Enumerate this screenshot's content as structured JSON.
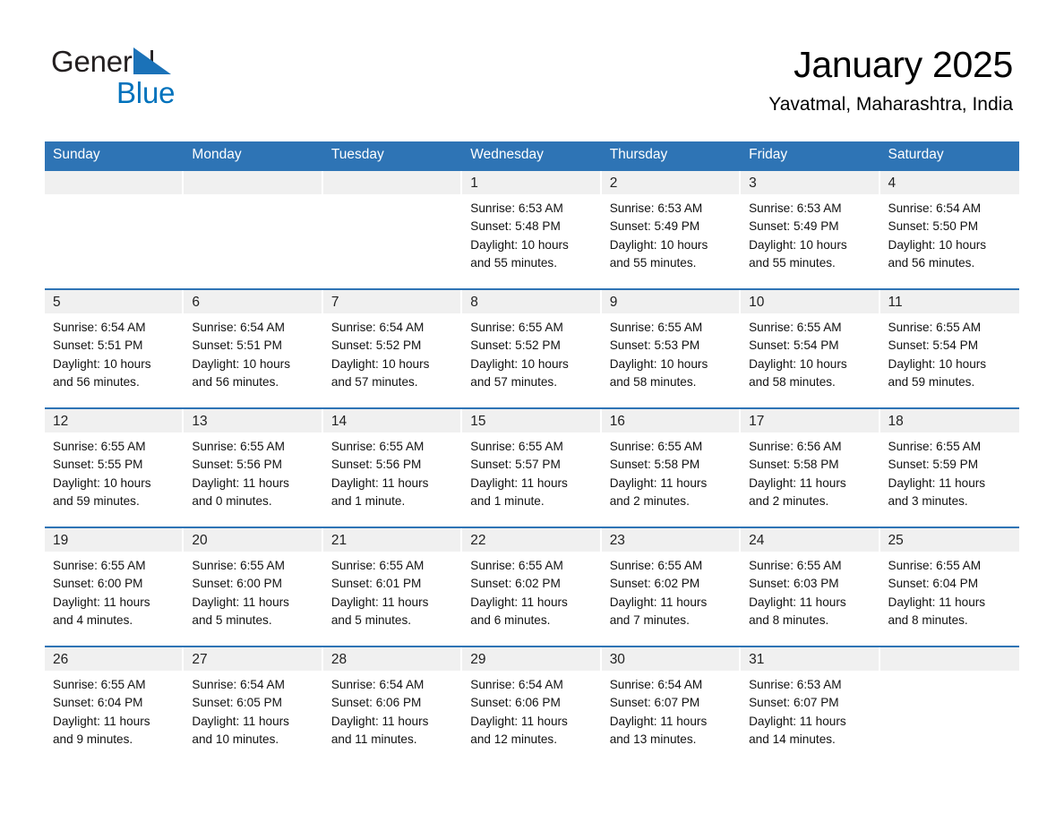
{
  "brand": {
    "name_part1": "General",
    "name_part2": "Blue",
    "triangle_icon": "triangle-icon",
    "accent_color": "#0072bc",
    "header_color": "#2e74b5"
  },
  "header": {
    "month_title": "January 2025",
    "location": "Yavatmal, Maharashtra, India"
  },
  "weekdays": [
    "Sunday",
    "Monday",
    "Tuesday",
    "Wednesday",
    "Thursday",
    "Friday",
    "Saturday"
  ],
  "weeks": [
    [
      {
        "day": "",
        "sunrise": "",
        "sunset": "",
        "daylight_line1": "",
        "daylight_line2": ""
      },
      {
        "day": "",
        "sunrise": "",
        "sunset": "",
        "daylight_line1": "",
        "daylight_line2": ""
      },
      {
        "day": "",
        "sunrise": "",
        "sunset": "",
        "daylight_line1": "",
        "daylight_line2": ""
      },
      {
        "day": "1",
        "sunrise": "Sunrise: 6:53 AM",
        "sunset": "Sunset: 5:48 PM",
        "daylight_line1": "Daylight: 10 hours",
        "daylight_line2": "and 55 minutes."
      },
      {
        "day": "2",
        "sunrise": "Sunrise: 6:53 AM",
        "sunset": "Sunset: 5:49 PM",
        "daylight_line1": "Daylight: 10 hours",
        "daylight_line2": "and 55 minutes."
      },
      {
        "day": "3",
        "sunrise": "Sunrise: 6:53 AM",
        "sunset": "Sunset: 5:49 PM",
        "daylight_line1": "Daylight: 10 hours",
        "daylight_line2": "and 55 minutes."
      },
      {
        "day": "4",
        "sunrise": "Sunrise: 6:54 AM",
        "sunset": "Sunset: 5:50 PM",
        "daylight_line1": "Daylight: 10 hours",
        "daylight_line2": "and 56 minutes."
      }
    ],
    [
      {
        "day": "5",
        "sunrise": "Sunrise: 6:54 AM",
        "sunset": "Sunset: 5:51 PM",
        "daylight_line1": "Daylight: 10 hours",
        "daylight_line2": "and 56 minutes."
      },
      {
        "day": "6",
        "sunrise": "Sunrise: 6:54 AM",
        "sunset": "Sunset: 5:51 PM",
        "daylight_line1": "Daylight: 10 hours",
        "daylight_line2": "and 56 minutes."
      },
      {
        "day": "7",
        "sunrise": "Sunrise: 6:54 AM",
        "sunset": "Sunset: 5:52 PM",
        "daylight_line1": "Daylight: 10 hours",
        "daylight_line2": "and 57 minutes."
      },
      {
        "day": "8",
        "sunrise": "Sunrise: 6:55 AM",
        "sunset": "Sunset: 5:52 PM",
        "daylight_line1": "Daylight: 10 hours",
        "daylight_line2": "and 57 minutes."
      },
      {
        "day": "9",
        "sunrise": "Sunrise: 6:55 AM",
        "sunset": "Sunset: 5:53 PM",
        "daylight_line1": "Daylight: 10 hours",
        "daylight_line2": "and 58 minutes."
      },
      {
        "day": "10",
        "sunrise": "Sunrise: 6:55 AM",
        "sunset": "Sunset: 5:54 PM",
        "daylight_line1": "Daylight: 10 hours",
        "daylight_line2": "and 58 minutes."
      },
      {
        "day": "11",
        "sunrise": "Sunrise: 6:55 AM",
        "sunset": "Sunset: 5:54 PM",
        "daylight_line1": "Daylight: 10 hours",
        "daylight_line2": "and 59 minutes."
      }
    ],
    [
      {
        "day": "12",
        "sunrise": "Sunrise: 6:55 AM",
        "sunset": "Sunset: 5:55 PM",
        "daylight_line1": "Daylight: 10 hours",
        "daylight_line2": "and 59 minutes."
      },
      {
        "day": "13",
        "sunrise": "Sunrise: 6:55 AM",
        "sunset": "Sunset: 5:56 PM",
        "daylight_line1": "Daylight: 11 hours",
        "daylight_line2": "and 0 minutes."
      },
      {
        "day": "14",
        "sunrise": "Sunrise: 6:55 AM",
        "sunset": "Sunset: 5:56 PM",
        "daylight_line1": "Daylight: 11 hours",
        "daylight_line2": "and 1 minute."
      },
      {
        "day": "15",
        "sunrise": "Sunrise: 6:55 AM",
        "sunset": "Sunset: 5:57 PM",
        "daylight_line1": "Daylight: 11 hours",
        "daylight_line2": "and 1 minute."
      },
      {
        "day": "16",
        "sunrise": "Sunrise: 6:55 AM",
        "sunset": "Sunset: 5:58 PM",
        "daylight_line1": "Daylight: 11 hours",
        "daylight_line2": "and 2 minutes."
      },
      {
        "day": "17",
        "sunrise": "Sunrise: 6:56 AM",
        "sunset": "Sunset: 5:58 PM",
        "daylight_line1": "Daylight: 11 hours",
        "daylight_line2": "and 2 minutes."
      },
      {
        "day": "18",
        "sunrise": "Sunrise: 6:55 AM",
        "sunset": "Sunset: 5:59 PM",
        "daylight_line1": "Daylight: 11 hours",
        "daylight_line2": "and 3 minutes."
      }
    ],
    [
      {
        "day": "19",
        "sunrise": "Sunrise: 6:55 AM",
        "sunset": "Sunset: 6:00 PM",
        "daylight_line1": "Daylight: 11 hours",
        "daylight_line2": "and 4 minutes."
      },
      {
        "day": "20",
        "sunrise": "Sunrise: 6:55 AM",
        "sunset": "Sunset: 6:00 PM",
        "daylight_line1": "Daylight: 11 hours",
        "daylight_line2": "and 5 minutes."
      },
      {
        "day": "21",
        "sunrise": "Sunrise: 6:55 AM",
        "sunset": "Sunset: 6:01 PM",
        "daylight_line1": "Daylight: 11 hours",
        "daylight_line2": "and 5 minutes."
      },
      {
        "day": "22",
        "sunrise": "Sunrise: 6:55 AM",
        "sunset": "Sunset: 6:02 PM",
        "daylight_line1": "Daylight: 11 hours",
        "daylight_line2": "and 6 minutes."
      },
      {
        "day": "23",
        "sunrise": "Sunrise: 6:55 AM",
        "sunset": "Sunset: 6:02 PM",
        "daylight_line1": "Daylight: 11 hours",
        "daylight_line2": "and 7 minutes."
      },
      {
        "day": "24",
        "sunrise": "Sunrise: 6:55 AM",
        "sunset": "Sunset: 6:03 PM",
        "daylight_line1": "Daylight: 11 hours",
        "daylight_line2": "and 8 minutes."
      },
      {
        "day": "25",
        "sunrise": "Sunrise: 6:55 AM",
        "sunset": "Sunset: 6:04 PM",
        "daylight_line1": "Daylight: 11 hours",
        "daylight_line2": "and 8 minutes."
      }
    ],
    [
      {
        "day": "26",
        "sunrise": "Sunrise: 6:55 AM",
        "sunset": "Sunset: 6:04 PM",
        "daylight_line1": "Daylight: 11 hours",
        "daylight_line2": "and 9 minutes."
      },
      {
        "day": "27",
        "sunrise": "Sunrise: 6:54 AM",
        "sunset": "Sunset: 6:05 PM",
        "daylight_line1": "Daylight: 11 hours",
        "daylight_line2": "and 10 minutes."
      },
      {
        "day": "28",
        "sunrise": "Sunrise: 6:54 AM",
        "sunset": "Sunset: 6:06 PM",
        "daylight_line1": "Daylight: 11 hours",
        "daylight_line2": "and 11 minutes."
      },
      {
        "day": "29",
        "sunrise": "Sunrise: 6:54 AM",
        "sunset": "Sunset: 6:06 PM",
        "daylight_line1": "Daylight: 11 hours",
        "daylight_line2": "and 12 minutes."
      },
      {
        "day": "30",
        "sunrise": "Sunrise: 6:54 AM",
        "sunset": "Sunset: 6:07 PM",
        "daylight_line1": "Daylight: 11 hours",
        "daylight_line2": "and 13 minutes."
      },
      {
        "day": "31",
        "sunrise": "Sunrise: 6:53 AM",
        "sunset": "Sunset: 6:07 PM",
        "daylight_line1": "Daylight: 11 hours",
        "daylight_line2": "and 14 minutes."
      },
      {
        "day": "",
        "sunrise": "",
        "sunset": "",
        "daylight_line1": "",
        "daylight_line2": ""
      }
    ]
  ]
}
